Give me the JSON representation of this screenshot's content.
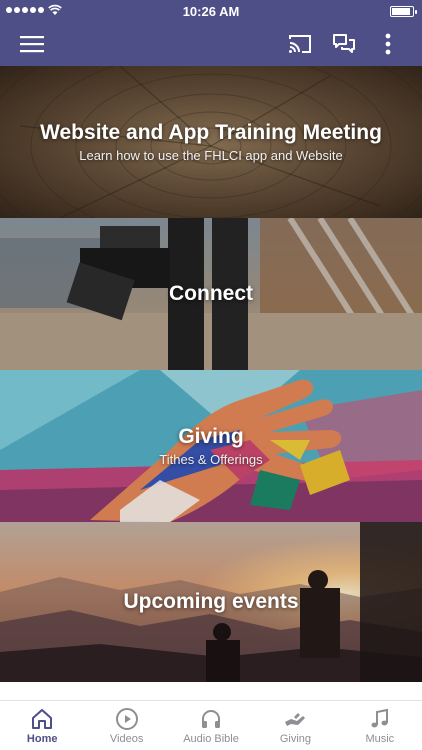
{
  "status_bar": {
    "time": "10:26 AM",
    "signal_icon": "signal-dots-icon",
    "wifi_icon": "wifi-icon",
    "battery_icon": "battery-icon",
    "battery_level": 0.95
  },
  "app_bar": {
    "menu_icon": "hamburger-menu-icon",
    "cast_icon": "cast-icon",
    "chat_icon": "chat-bubbles-icon",
    "more_icon": "more-vertical-icon",
    "background_color": "#4f4f88"
  },
  "cards": [
    {
      "title": "Website and App Training Meeting",
      "subtitle": "Learn how to use the FHLCI app and Website",
      "image": "wood-rings-image"
    },
    {
      "title": "Connect",
      "subtitle": "",
      "image": "camera-operator-image"
    },
    {
      "title": "Giving",
      "subtitle": "Tithes & Offerings",
      "image": "painted-hands-mural-image"
    },
    {
      "title": "Upcoming events",
      "subtitle": "",
      "image": "sunset-mountains-image"
    }
  ],
  "tabs": [
    {
      "label": "Home",
      "icon": "home-icon",
      "active": true
    },
    {
      "label": "Videos",
      "icon": "play-circle-icon",
      "active": false
    },
    {
      "label": "Audio Bible",
      "icon": "headphones-icon",
      "active": false
    },
    {
      "label": "Giving",
      "icon": "giving-hand-icon",
      "active": false
    },
    {
      "label": "Music",
      "icon": "music-note-icon",
      "active": false
    }
  ],
  "colors": {
    "accent": "#4f4f88",
    "tab_inactive": "#8e8e93"
  }
}
